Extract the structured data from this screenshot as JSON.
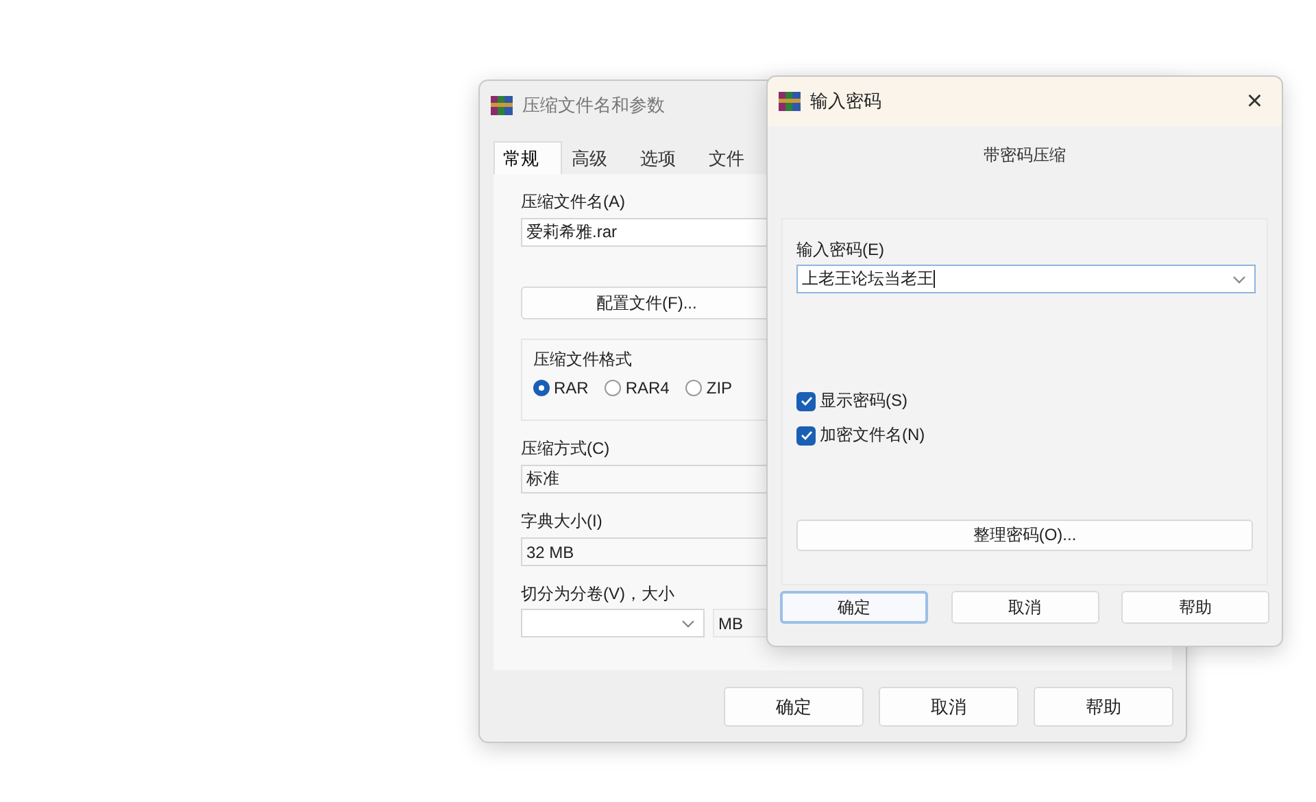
{
  "archive_window": {
    "title": "压缩文件名和参数",
    "tabs": [
      {
        "label": "常规",
        "selected": true
      },
      {
        "label": "高级",
        "selected": false
      },
      {
        "label": "选项",
        "selected": false
      },
      {
        "label": "文件",
        "selected": false
      }
    ],
    "archive_name": {
      "label": "压缩文件名(A)",
      "value": "爱莉希雅.rar"
    },
    "profiles_button": "配置文件(F)...",
    "format": {
      "label": "压缩文件格式",
      "options": [
        {
          "label": "RAR",
          "selected": true
        },
        {
          "label": "RAR4",
          "selected": false
        },
        {
          "label": "ZIP",
          "selected": false
        }
      ]
    },
    "method": {
      "label": "压缩方式(C)",
      "value": "标准"
    },
    "dictionary": {
      "label": "字典大小(I)",
      "value": "32 MB"
    },
    "split": {
      "label": "切分为分卷(V)，大小",
      "unit": "MB"
    },
    "buttons": [
      "确定",
      "取消",
      "帮助"
    ]
  },
  "password_dialog": {
    "title": "输入密码",
    "close": "×",
    "heading": "带密码压缩",
    "password": {
      "label": "输入密码(E)",
      "value": "上老王论坛当老王"
    },
    "options": [
      {
        "label": "显示密码(S)",
        "checked": true
      },
      {
        "label": "加密文件名(N)",
        "checked": true
      }
    ],
    "organize_button": "整理密码(O)...",
    "buttons": [
      {
        "label": "确定",
        "focused": true
      },
      {
        "label": "取消",
        "focused": false
      },
      {
        "label": "帮助",
        "focused": false
      }
    ]
  }
}
